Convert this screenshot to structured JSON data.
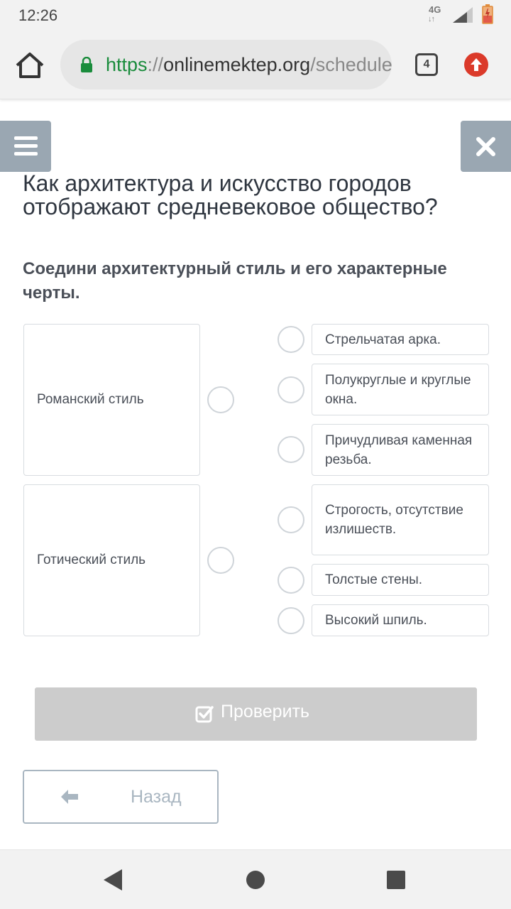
{
  "status_bar": {
    "time": "12:26",
    "network": "4G",
    "network_arrows": "↓↑"
  },
  "browser": {
    "url_scheme": "https",
    "url_separator": "://",
    "url_host": "onlinemektep.org",
    "url_path": "/schedule",
    "tab_count": "4"
  },
  "lesson": {
    "title": "Как архитектура и искусство городов отображают средневековое общество?"
  },
  "task": {
    "instruction": "Соедини архитектурный стиль и его характерные черты.",
    "styles": [
      {
        "label": "Романский стиль"
      },
      {
        "label": "Готический стиль"
      }
    ],
    "features": [
      {
        "label": "Стрельчатая арка."
      },
      {
        "label": "Полукруглые и круглые окна."
      },
      {
        "label": "Причудливая каменная резьба."
      },
      {
        "label": "Строгость, отсутствие излишеств."
      },
      {
        "label": "Толстые стены."
      },
      {
        "label": "Высокий шпиль."
      }
    ]
  },
  "buttons": {
    "check": "Проверить",
    "back": "Назад"
  },
  "colors": {
    "accent_gray": "#9aa7b2",
    "url_green": "#1a8c3c",
    "update_red": "#db3a2a",
    "disabled_button": "#cccccc"
  },
  "icons": [
    "home-icon",
    "lock-icon",
    "tabs-icon",
    "update-icon",
    "menu-icon",
    "close-icon",
    "check-icon",
    "arrow-left-icon"
  ]
}
